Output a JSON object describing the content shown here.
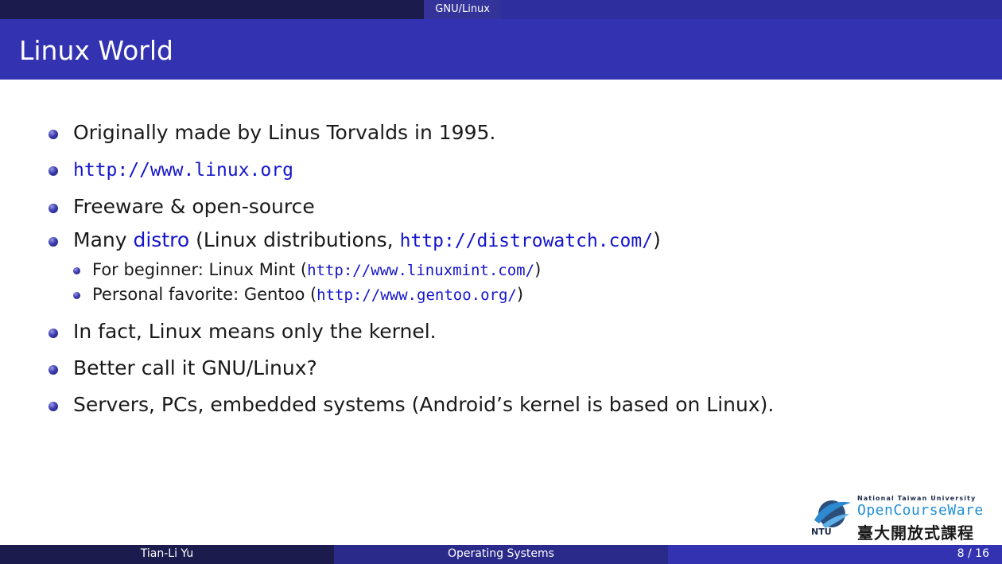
{
  "header": {
    "section": "GNU/Linux"
  },
  "slide": {
    "title": "Linux World",
    "bullets": [
      {
        "text": "Originally made by Linus Torvalds in 1995."
      },
      {
        "link": "http://www.linux.org"
      },
      {
        "text": "Freeware & open-source"
      },
      {
        "pre": "Many ",
        "highlight": "distro",
        "mid": " (Linux distributions, ",
        "link": "http://distrowatch.com/",
        "post": ")"
      },
      {
        "text": "In fact, Linux means only the kernel."
      },
      {
        "text": "Better call it GNU/Linux?"
      },
      {
        "text": "Servers, PCs, embedded systems (Android’s kernel is based on Linux)."
      }
    ],
    "subbullets": [
      {
        "pre": "For beginner: Linux Mint (",
        "link": "http://www.linuxmint.com/",
        "post": ")"
      },
      {
        "pre": "Personal favorite: Gentoo (",
        "link": "http://www.gentoo.org/",
        "post": ")"
      }
    ]
  },
  "logo": {
    "university": "National Taiwan University",
    "name": "OpenCourseWare",
    "chinese": "臺大開放式課程",
    "abbr": "NTU"
  },
  "footer": {
    "author": "Tian-Li Yu",
    "course": "Operating Systems",
    "page": "8 / 16"
  },
  "colors": {
    "title_band": "#3333b2",
    "dark_band": "#1b1b4d",
    "link": "#1515cc"
  },
  "icons": {
    "bullet": "ball-bullet-icon",
    "logo": "ntu-ocw-logo-icon"
  }
}
